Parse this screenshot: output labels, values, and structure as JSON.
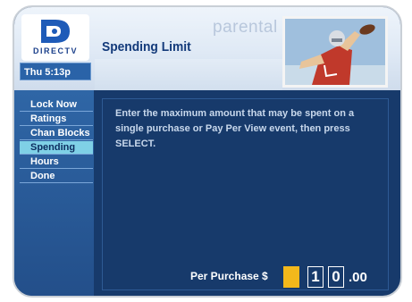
{
  "header": {
    "watermark": "parental",
    "title": "Spending Limit",
    "logo_text": "DIRECTV",
    "time": "Thu 5:13p"
  },
  "menu": {
    "items": [
      {
        "label": "Lock Now",
        "selected": false
      },
      {
        "label": "Ratings",
        "selected": false
      },
      {
        "label": "Chan Blocks",
        "selected": false
      },
      {
        "label": "Spending",
        "selected": true
      },
      {
        "label": "Hours",
        "selected": false
      },
      {
        "label": "Done",
        "selected": false
      }
    ]
  },
  "content": {
    "instructions": "Enter the maximum amount that may be spent on a single purchase or Pay Per View event, then press SELECT.",
    "entry_label": "Per Purchase $",
    "digits": [
      "",
      "1",
      "0"
    ],
    "cents": ".00"
  },
  "colors": {
    "accent_yellow": "#f3b81b",
    "selected_item": "#7fd0e6",
    "background_navy": "#173a6b"
  }
}
